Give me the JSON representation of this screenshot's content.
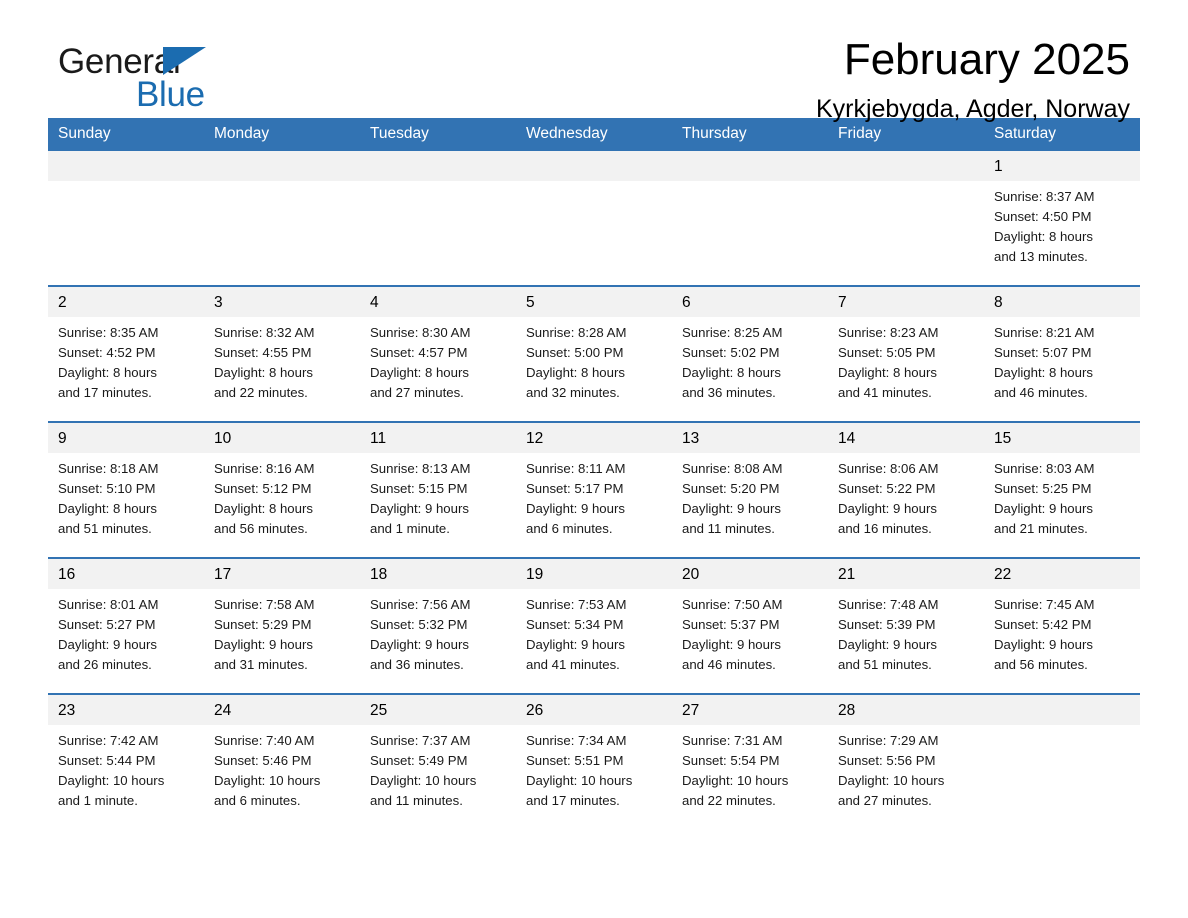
{
  "brand": {
    "name_part1": "General",
    "name_part2": "Blue",
    "triangle_color": "#1b6cb0"
  },
  "header": {
    "title": "February 2025",
    "subtitle": "Kyrkjebygda, Agder, Norway"
  },
  "theme": {
    "header_blue": "#3273b3",
    "daynum_bg": "#f2f2f2",
    "text": "#1a1a1a"
  },
  "weekdays": [
    "Sunday",
    "Monday",
    "Tuesday",
    "Wednesday",
    "Thursday",
    "Friday",
    "Saturday"
  ],
  "weeks": [
    [
      {
        "day": "",
        "sunrise": "",
        "sunset": "",
        "daylight1": "",
        "daylight2": "",
        "empty": true
      },
      {
        "day": "",
        "sunrise": "",
        "sunset": "",
        "daylight1": "",
        "daylight2": "",
        "empty": true
      },
      {
        "day": "",
        "sunrise": "",
        "sunset": "",
        "daylight1": "",
        "daylight2": "",
        "empty": true
      },
      {
        "day": "",
        "sunrise": "",
        "sunset": "",
        "daylight1": "",
        "daylight2": "",
        "empty": true
      },
      {
        "day": "",
        "sunrise": "",
        "sunset": "",
        "daylight1": "",
        "daylight2": "",
        "empty": true
      },
      {
        "day": "",
        "sunrise": "",
        "sunset": "",
        "daylight1": "",
        "daylight2": "",
        "empty": true
      },
      {
        "day": "1",
        "sunrise": "Sunrise: 8:37 AM",
        "sunset": "Sunset: 4:50 PM",
        "daylight1": "Daylight: 8 hours",
        "daylight2": "and 13 minutes.",
        "empty": false
      }
    ],
    [
      {
        "day": "2",
        "sunrise": "Sunrise: 8:35 AM",
        "sunset": "Sunset: 4:52 PM",
        "daylight1": "Daylight: 8 hours",
        "daylight2": "and 17 minutes.",
        "empty": false
      },
      {
        "day": "3",
        "sunrise": "Sunrise: 8:32 AM",
        "sunset": "Sunset: 4:55 PM",
        "daylight1": "Daylight: 8 hours",
        "daylight2": "and 22 minutes.",
        "empty": false
      },
      {
        "day": "4",
        "sunrise": "Sunrise: 8:30 AM",
        "sunset": "Sunset: 4:57 PM",
        "daylight1": "Daylight: 8 hours",
        "daylight2": "and 27 minutes.",
        "empty": false
      },
      {
        "day": "5",
        "sunrise": "Sunrise: 8:28 AM",
        "sunset": "Sunset: 5:00 PM",
        "daylight1": "Daylight: 8 hours",
        "daylight2": "and 32 minutes.",
        "empty": false
      },
      {
        "day": "6",
        "sunrise": "Sunrise: 8:25 AM",
        "sunset": "Sunset: 5:02 PM",
        "daylight1": "Daylight: 8 hours",
        "daylight2": "and 36 minutes.",
        "empty": false
      },
      {
        "day": "7",
        "sunrise": "Sunrise: 8:23 AM",
        "sunset": "Sunset: 5:05 PM",
        "daylight1": "Daylight: 8 hours",
        "daylight2": "and 41 minutes.",
        "empty": false
      },
      {
        "day": "8",
        "sunrise": "Sunrise: 8:21 AM",
        "sunset": "Sunset: 5:07 PM",
        "daylight1": "Daylight: 8 hours",
        "daylight2": "and 46 minutes.",
        "empty": false
      }
    ],
    [
      {
        "day": "9",
        "sunrise": "Sunrise: 8:18 AM",
        "sunset": "Sunset: 5:10 PM",
        "daylight1": "Daylight: 8 hours",
        "daylight2": "and 51 minutes.",
        "empty": false
      },
      {
        "day": "10",
        "sunrise": "Sunrise: 8:16 AM",
        "sunset": "Sunset: 5:12 PM",
        "daylight1": "Daylight: 8 hours",
        "daylight2": "and 56 minutes.",
        "empty": false
      },
      {
        "day": "11",
        "sunrise": "Sunrise: 8:13 AM",
        "sunset": "Sunset: 5:15 PM",
        "daylight1": "Daylight: 9 hours",
        "daylight2": "and 1 minute.",
        "empty": false
      },
      {
        "day": "12",
        "sunrise": "Sunrise: 8:11 AM",
        "sunset": "Sunset: 5:17 PM",
        "daylight1": "Daylight: 9 hours",
        "daylight2": "and 6 minutes.",
        "empty": false
      },
      {
        "day": "13",
        "sunrise": "Sunrise: 8:08 AM",
        "sunset": "Sunset: 5:20 PM",
        "daylight1": "Daylight: 9 hours",
        "daylight2": "and 11 minutes.",
        "empty": false
      },
      {
        "day": "14",
        "sunrise": "Sunrise: 8:06 AM",
        "sunset": "Sunset: 5:22 PM",
        "daylight1": "Daylight: 9 hours",
        "daylight2": "and 16 minutes.",
        "empty": false
      },
      {
        "day": "15",
        "sunrise": "Sunrise: 8:03 AM",
        "sunset": "Sunset: 5:25 PM",
        "daylight1": "Daylight: 9 hours",
        "daylight2": "and 21 minutes.",
        "empty": false
      }
    ],
    [
      {
        "day": "16",
        "sunrise": "Sunrise: 8:01 AM",
        "sunset": "Sunset: 5:27 PM",
        "daylight1": "Daylight: 9 hours",
        "daylight2": "and 26 minutes.",
        "empty": false
      },
      {
        "day": "17",
        "sunrise": "Sunrise: 7:58 AM",
        "sunset": "Sunset: 5:29 PM",
        "daylight1": "Daylight: 9 hours",
        "daylight2": "and 31 minutes.",
        "empty": false
      },
      {
        "day": "18",
        "sunrise": "Sunrise: 7:56 AM",
        "sunset": "Sunset: 5:32 PM",
        "daylight1": "Daylight: 9 hours",
        "daylight2": "and 36 minutes.",
        "empty": false
      },
      {
        "day": "19",
        "sunrise": "Sunrise: 7:53 AM",
        "sunset": "Sunset: 5:34 PM",
        "daylight1": "Daylight: 9 hours",
        "daylight2": "and 41 minutes.",
        "empty": false
      },
      {
        "day": "20",
        "sunrise": "Sunrise: 7:50 AM",
        "sunset": "Sunset: 5:37 PM",
        "daylight1": "Daylight: 9 hours",
        "daylight2": "and 46 minutes.",
        "empty": false
      },
      {
        "day": "21",
        "sunrise": "Sunrise: 7:48 AM",
        "sunset": "Sunset: 5:39 PM",
        "daylight1": "Daylight: 9 hours",
        "daylight2": "and 51 minutes.",
        "empty": false
      },
      {
        "day": "22",
        "sunrise": "Sunrise: 7:45 AM",
        "sunset": "Sunset: 5:42 PM",
        "daylight1": "Daylight: 9 hours",
        "daylight2": "and 56 minutes.",
        "empty": false
      }
    ],
    [
      {
        "day": "23",
        "sunrise": "Sunrise: 7:42 AM",
        "sunset": "Sunset: 5:44 PM",
        "daylight1": "Daylight: 10 hours",
        "daylight2": "and 1 minute.",
        "empty": false
      },
      {
        "day": "24",
        "sunrise": "Sunrise: 7:40 AM",
        "sunset": "Sunset: 5:46 PM",
        "daylight1": "Daylight: 10 hours",
        "daylight2": "and 6 minutes.",
        "empty": false
      },
      {
        "day": "25",
        "sunrise": "Sunrise: 7:37 AM",
        "sunset": "Sunset: 5:49 PM",
        "daylight1": "Daylight: 10 hours",
        "daylight2": "and 11 minutes.",
        "empty": false
      },
      {
        "day": "26",
        "sunrise": "Sunrise: 7:34 AM",
        "sunset": "Sunset: 5:51 PM",
        "daylight1": "Daylight: 10 hours",
        "daylight2": "and 17 minutes.",
        "empty": false
      },
      {
        "day": "27",
        "sunrise": "Sunrise: 7:31 AM",
        "sunset": "Sunset: 5:54 PM",
        "daylight1": "Daylight: 10 hours",
        "daylight2": "and 22 minutes.",
        "empty": false
      },
      {
        "day": "28",
        "sunrise": "Sunrise: 7:29 AM",
        "sunset": "Sunset: 5:56 PM",
        "daylight1": "Daylight: 10 hours",
        "daylight2": "and 27 minutes.",
        "empty": false
      },
      {
        "day": "",
        "sunrise": "",
        "sunset": "",
        "daylight1": "",
        "daylight2": "",
        "empty": true
      }
    ]
  ]
}
